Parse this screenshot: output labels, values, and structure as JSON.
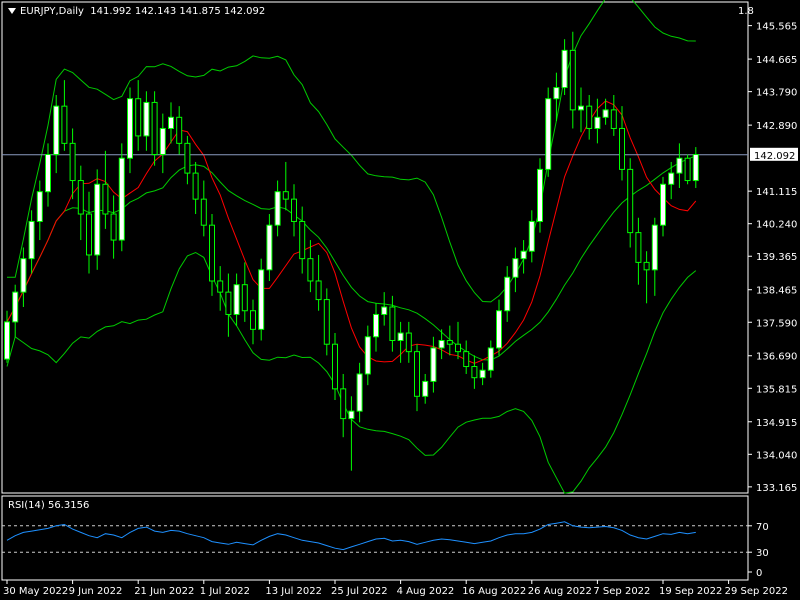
{
  "header": {
    "symbol": "EURJPY,Daily",
    "ohlc": "141.992 142.143 141.875 142.092",
    "zoom": "1.8"
  },
  "rsi_label": "RSI(14) 56.3156",
  "colors": {
    "background": "#000000",
    "frame": "#ffffff",
    "bull_candle": "#ffffff",
    "bear_candle": "#000000",
    "wick": "#00ff00",
    "bands": "#00cc00",
    "ma": "#ff0000",
    "rsi": "#1e90ff",
    "price_line": "#8a9bc0"
  },
  "chart_data": [
    {
      "type": "candlestick",
      "name": "EURJPY,Daily",
      "current_price": 142.092,
      "current_price_label": "142.092",
      "y_ticks": [
        "145.565",
        "144.665",
        "143.790",
        "142.890",
        "141.115",
        "140.240",
        "139.365",
        "138.465",
        "137.590",
        "136.690",
        "135.815",
        "134.915",
        "134.040",
        "133.165"
      ],
      "y_range": [
        133.0,
        146.2
      ],
      "x_ticks": [
        {
          "label": "30 May 2022",
          "index": 0
        },
        {
          "label": "9 Jun 2022",
          "index": 8
        },
        {
          "label": "21 Jun 2022",
          "index": 16
        },
        {
          "label": "1 Jul 2022",
          "index": 24
        },
        {
          "label": "13 Jul 2022",
          "index": 32
        },
        {
          "label": "25 Jul 2022",
          "index": 40
        },
        {
          "label": "4 Aug 2022",
          "index": 48
        },
        {
          "label": "16 Aug 2022",
          "index": 56
        },
        {
          "label": "26 Aug 2022",
          "index": 64
        },
        {
          "label": "7 Sep 2022",
          "index": 72
        },
        {
          "label": "19 Sep 2022",
          "index": 80
        },
        {
          "label": "29 Sep 2022",
          "index": 88
        }
      ],
      "candles": [
        [
          136.6,
          137.9,
          136.5,
          137.6
        ],
        [
          137.6,
          138.6,
          137.2,
          138.4
        ],
        [
          138.4,
          139.6,
          138.0,
          139.3
        ],
        [
          139.3,
          140.6,
          138.9,
          140.3
        ],
        [
          140.3,
          141.4,
          139.8,
          141.1
        ],
        [
          141.1,
          142.4,
          140.7,
          142.1
        ],
        [
          142.1,
          143.7,
          141.6,
          143.4
        ],
        [
          143.4,
          144.1,
          142.2,
          142.4
        ],
        [
          142.4,
          142.8,
          140.9,
          141.4
        ],
        [
          141.4,
          141.8,
          139.8,
          140.5
        ],
        [
          140.5,
          141.1,
          138.9,
          139.4
        ],
        [
          139.4,
          141.7,
          139.0,
          141.3
        ],
        [
          141.3,
          142.2,
          140.1,
          140.5
        ],
        [
          140.5,
          141.0,
          139.3,
          139.8
        ],
        [
          139.8,
          142.4,
          139.5,
          142.0
        ],
        [
          142.0,
          143.9,
          141.6,
          143.6
        ],
        [
          143.6,
          144.1,
          142.2,
          142.6
        ],
        [
          142.6,
          143.8,
          142.2,
          143.5
        ],
        [
          143.5,
          143.8,
          141.8,
          142.1
        ],
        [
          142.1,
          143.2,
          141.6,
          142.8
        ],
        [
          142.8,
          143.5,
          142.4,
          143.1
        ],
        [
          143.1,
          143.4,
          142.1,
          142.4
        ],
        [
          142.4,
          142.6,
          141.3,
          141.6
        ],
        [
          141.6,
          141.9,
          140.5,
          140.9
        ],
        [
          140.9,
          141.4,
          139.9,
          140.2
        ],
        [
          140.2,
          140.5,
          138.3,
          138.7
        ],
        [
          138.7,
          139.1,
          137.9,
          138.4
        ],
        [
          138.4,
          138.9,
          137.2,
          137.8
        ],
        [
          137.8,
          138.9,
          137.5,
          138.6
        ],
        [
          138.6,
          139.2,
          137.6,
          137.9
        ],
        [
          137.9,
          138.2,
          137.0,
          137.4
        ],
        [
          137.4,
          139.3,
          137.1,
          139.0
        ],
        [
          139.0,
          140.5,
          138.7,
          140.2
        ],
        [
          140.2,
          141.4,
          139.9,
          141.1
        ],
        [
          141.1,
          141.9,
          140.6,
          140.9
        ],
        [
          140.9,
          141.3,
          139.9,
          140.3
        ],
        [
          140.3,
          140.7,
          138.9,
          139.3
        ],
        [
          139.3,
          139.8,
          138.4,
          138.7
        ],
        [
          138.7,
          139.4,
          137.9,
          138.2
        ],
        [
          138.2,
          138.5,
          136.7,
          137.0
        ],
        [
          137.0,
          137.3,
          135.5,
          135.8
        ],
        [
          135.8,
          136.2,
          134.5,
          135.0
        ],
        [
          135.0,
          135.6,
          133.6,
          135.2
        ],
        [
          135.2,
          136.5,
          134.9,
          136.2
        ],
        [
          136.2,
          137.5,
          135.9,
          137.2
        ],
        [
          137.2,
          138.1,
          136.8,
          137.8
        ],
        [
          137.8,
          138.4,
          137.5,
          138.0
        ],
        [
          138.0,
          138.3,
          136.8,
          137.1
        ],
        [
          137.1,
          137.6,
          136.5,
          137.3
        ],
        [
          137.3,
          137.6,
          136.5,
          136.8
        ],
        [
          136.8,
          137.0,
          135.2,
          135.6
        ],
        [
          135.6,
          136.2,
          135.4,
          136.0
        ],
        [
          136.0,
          137.2,
          135.7,
          136.9
        ],
        [
          136.9,
          137.4,
          136.6,
          137.1
        ],
        [
          137.1,
          137.5,
          136.7,
          137.0
        ],
        [
          137.0,
          137.6,
          136.6,
          136.8
        ],
        [
          136.8,
          137.1,
          136.2,
          136.4
        ],
        [
          136.4,
          136.7,
          135.8,
          136.1
        ],
        [
          136.1,
          136.5,
          135.9,
          136.3
        ],
        [
          136.3,
          137.1,
          136.1,
          136.9
        ],
        [
          136.9,
          138.2,
          136.7,
          137.9
        ],
        [
          137.9,
          139.1,
          137.6,
          138.8
        ],
        [
          138.8,
          139.6,
          138.4,
          139.3
        ],
        [
          139.3,
          139.8,
          138.9,
          139.5
        ],
        [
          139.5,
          140.6,
          139.2,
          140.3
        ],
        [
          140.3,
          142.0,
          140.0,
          141.7
        ],
        [
          141.7,
          143.9,
          141.5,
          143.6
        ],
        [
          143.6,
          144.3,
          143.0,
          143.9
        ],
        [
          143.9,
          145.2,
          143.7,
          144.9
        ],
        [
          144.9,
          145.4,
          142.8,
          143.3
        ],
        [
          143.3,
          143.9,
          142.7,
          143.4
        ],
        [
          143.4,
          143.7,
          142.5,
          142.8
        ],
        [
          142.8,
          143.6,
          142.4,
          143.1
        ],
        [
          143.1,
          143.6,
          142.9,
          143.3
        ],
        [
          143.3,
          143.7,
          142.6,
          142.8
        ],
        [
          142.8,
          143.4,
          141.4,
          141.7
        ],
        [
          141.7,
          142.0,
          139.6,
          140.0
        ],
        [
          140.0,
          140.4,
          138.6,
          139.2
        ],
        [
          139.2,
          139.5,
          138.1,
          139.0
        ],
        [
          139.0,
          140.4,
          138.3,
          140.2
        ],
        [
          140.2,
          141.5,
          139.9,
          141.3
        ],
        [
          141.3,
          141.9,
          140.9,
          141.6
        ],
        [
          141.6,
          142.4,
          141.2,
          142.0
        ],
        [
          142.0,
          142.1,
          141.3,
          141.4
        ],
        [
          141.4,
          142.3,
          141.2,
          142.1
        ]
      ]
    },
    {
      "type": "line",
      "name": "RSI(14)",
      "last_value": 56.3156,
      "levels": [
        70,
        30
      ],
      "y_ticks": [
        "70",
        "30",
        "0"
      ],
      "y_range": [
        0,
        100
      ],
      "values": [
        48,
        55,
        60,
        62,
        64,
        66,
        70,
        72,
        65,
        60,
        55,
        52,
        58,
        56,
        52,
        60,
        66,
        68,
        62,
        60,
        63,
        62,
        58,
        55,
        52,
        46,
        44,
        42,
        45,
        43,
        41,
        48,
        54,
        58,
        56,
        52,
        48,
        46,
        44,
        40,
        36,
        34,
        38,
        42,
        46,
        50,
        51,
        47,
        48,
        46,
        42,
        45,
        48,
        50,
        49,
        47,
        45,
        43,
        45,
        47,
        52,
        56,
        58,
        58,
        60,
        65,
        72,
        74,
        76,
        70,
        68,
        67,
        68,
        69,
        67,
        63,
        56,
        52,
        50,
        54,
        58,
        57,
        60,
        58,
        60
      ]
    }
  ]
}
